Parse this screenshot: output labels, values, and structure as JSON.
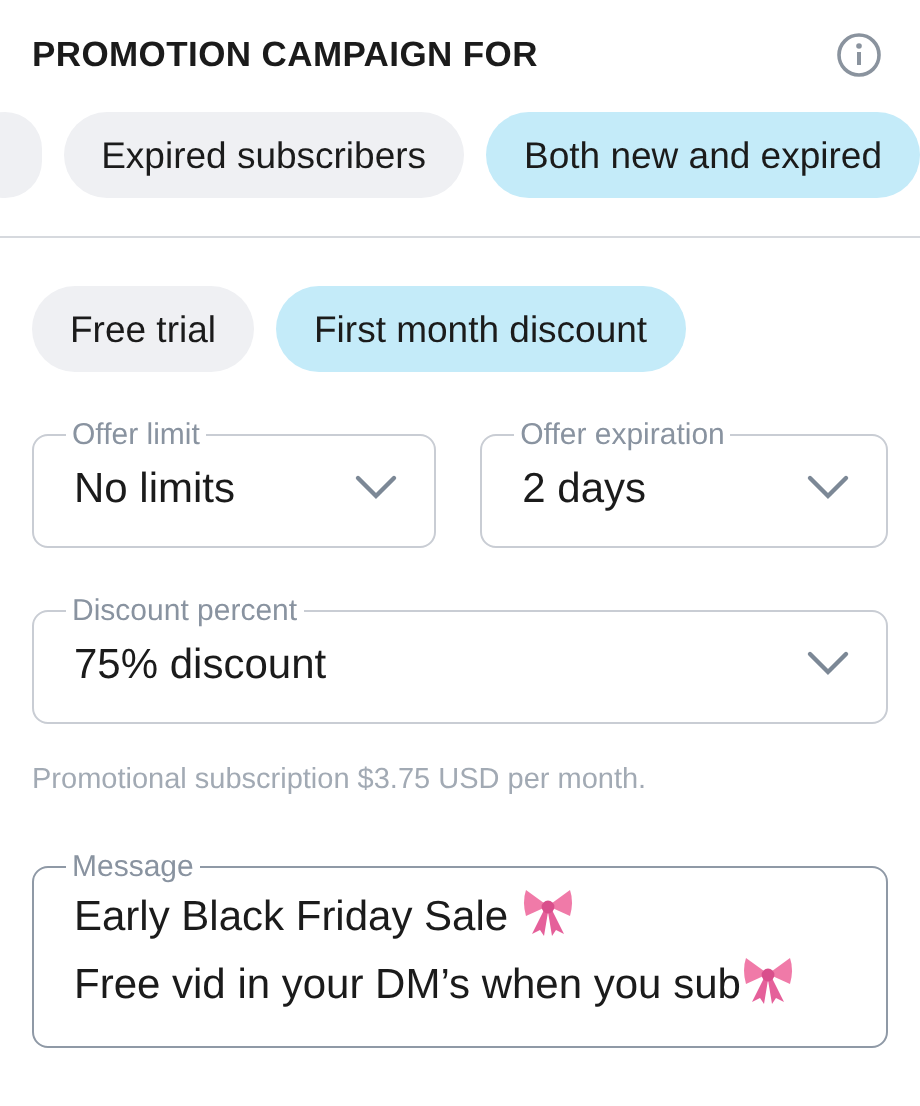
{
  "header": {
    "title": "PROMOTION CAMPAIGN FOR"
  },
  "audience_options": [
    {
      "selected": false
    },
    {
      "label": "Expired subscribers",
      "selected": false
    },
    {
      "label": "Both new and expired",
      "selected": true
    }
  ],
  "offer_types": [
    {
      "label": "Free trial",
      "selected": false
    },
    {
      "label": "First month discount",
      "selected": true
    }
  ],
  "selects": [
    {
      "label": "Offer limit",
      "value": "No limits"
    },
    {
      "label": "Offer expiration",
      "value": "2 days"
    },
    {
      "label": "Discount percent",
      "value": "75% discount"
    }
  ],
  "hint": "Promotional subscription $3.75 USD per month.",
  "message": {
    "label": "Message",
    "lines": [
      {
        "text": "Early Black Friday Sale ",
        "kind": "decorated"
      },
      {
        "text": "Free vid in your DM’s when you sub",
        "kind": "decorated"
      }
    ]
  }
}
